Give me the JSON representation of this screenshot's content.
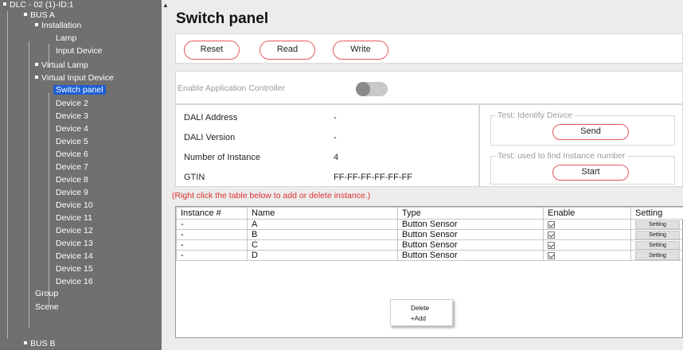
{
  "tree": {
    "root": "DLC - 02 (1)-ID:1",
    "items": [
      {
        "label": "BUS A"
      },
      {
        "label": "Installation"
      },
      {
        "label": "Lamp"
      },
      {
        "label": "Input Device"
      },
      {
        "label": "Virtual Lamp"
      },
      {
        "label": "Virtual Input Device"
      },
      {
        "label": "Switch panel",
        "selected": true
      },
      {
        "label": "Device 2"
      },
      {
        "label": "Device 3"
      },
      {
        "label": "Device 4"
      },
      {
        "label": "Device 5"
      },
      {
        "label": "Device 6"
      },
      {
        "label": "Device 7"
      },
      {
        "label": "Device 8"
      },
      {
        "label": "Device 9"
      },
      {
        "label": "Device 10"
      },
      {
        "label": "Device 11"
      },
      {
        "label": "Device 12"
      },
      {
        "label": "Device 13"
      },
      {
        "label": "Device 14"
      },
      {
        "label": "Device 15"
      },
      {
        "label": "Device 16"
      },
      {
        "label": "Group"
      },
      {
        "label": "Scene"
      },
      {
        "label": "BUS B"
      }
    ]
  },
  "page": {
    "title": "Switch panel"
  },
  "toolbar": {
    "reset": "Reset",
    "read": "Read",
    "write": "Write"
  },
  "app_controller": {
    "label": "Enable Application Controller",
    "enabled": false
  },
  "info": {
    "dali_address_label": "DALI Address",
    "dali_address_value": "-",
    "dali_version_label": "DALI Version",
    "dali_version_value": "-",
    "instances_label": "Number of Instance",
    "instances_value": "4",
    "gtin_label": "GTIN",
    "gtin_value": "FF-FF-FF-FF-FF-FF"
  },
  "tests": {
    "identify_title": "Test: Identify Deivce",
    "identify_button": "Send",
    "instance_title": "Test: used to find Instance number",
    "instance_button": "Start"
  },
  "hint": "(Right click the table below to add or delete instance.)",
  "table": {
    "headers": [
      "Instance #",
      "Name",
      "Type",
      "Enable",
      "Setting"
    ],
    "rows": [
      {
        "instance": "-",
        "name": "A",
        "type": "Button Sensor",
        "enabled": true,
        "setting": "Setting"
      },
      {
        "instance": "-",
        "name": "B",
        "type": "Button Sensor",
        "enabled": true,
        "setting": "Setting"
      },
      {
        "instance": "-",
        "name": "C",
        "type": "Button Sensor",
        "enabled": true,
        "setting": "Setting"
      },
      {
        "instance": "-",
        "name": "D",
        "type": "Button Sensor",
        "enabled": true,
        "setting": "Setting"
      }
    ]
  },
  "context_menu": {
    "delete": "Delete",
    "add": "+Add"
  },
  "colors": {
    "accent_border": "#e2595f",
    "selected_bg": "#1f5fd4",
    "hint_text": "#e03030",
    "sidebar_bg": "#707070"
  }
}
